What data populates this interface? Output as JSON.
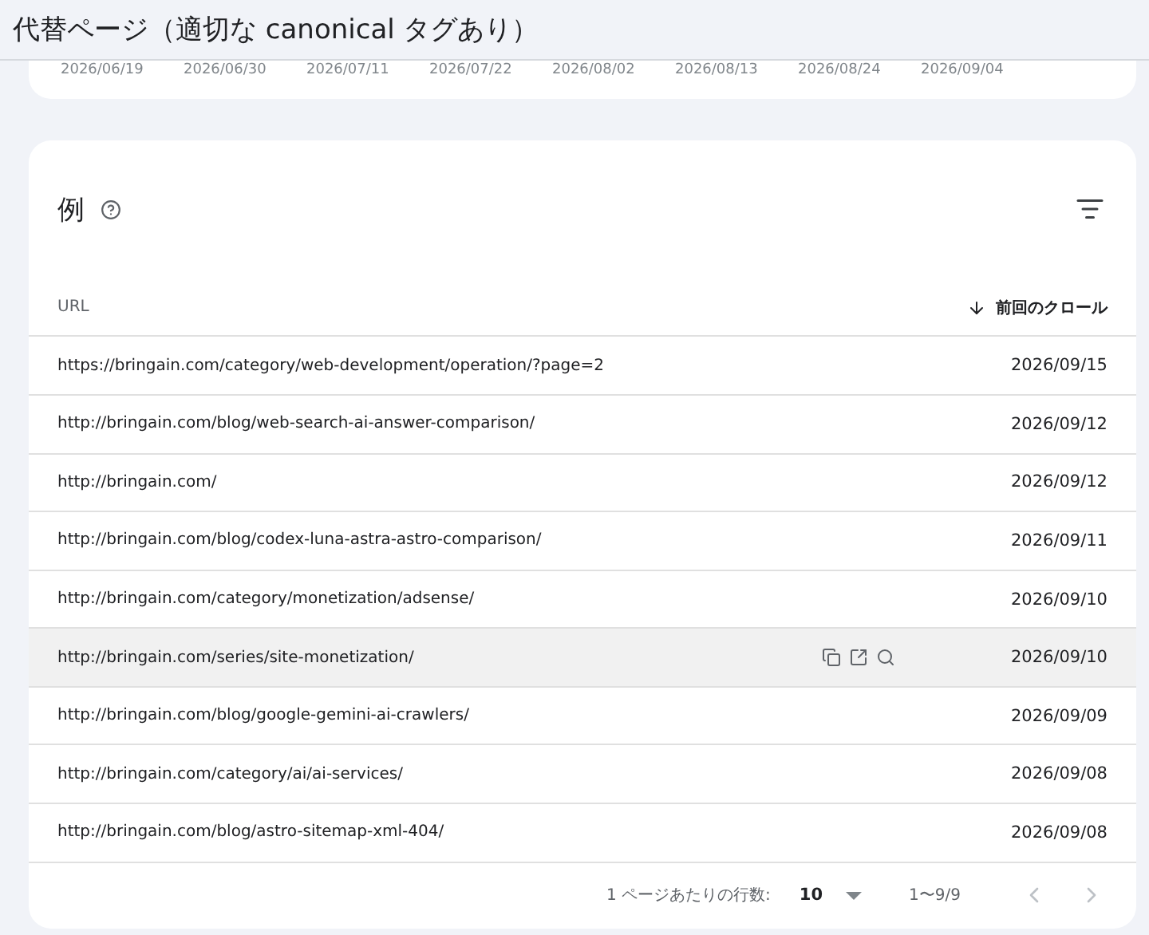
{
  "page_title": "代替ページ（適切な canonical タグあり）",
  "chart_axis": {
    "dates": [
      "2026/06/19",
      "2026/06/30",
      "2026/07/11",
      "2026/07/22",
      "2026/08/02",
      "2026/08/13",
      "2026/08/24",
      "2026/09/04"
    ]
  },
  "examples": {
    "title": "例",
    "columns": [
      {
        "label": "URL",
        "sorted": false
      },
      {
        "label": "前回のクロール",
        "sorted": true
      }
    ],
    "rows": [
      {
        "url": "https://bringain.com/category/web-development/operation/?page=2",
        "date": "2026/09/15",
        "hovered": false
      },
      {
        "url": "http://bringain.com/blog/web-search-ai-answer-comparison/",
        "date": "2026/09/12",
        "hovered": false
      },
      {
        "url": "http://bringain.com/",
        "date": "2026/09/12",
        "hovered": false
      },
      {
        "url": "http://bringain.com/blog/codex-luna-astra-astro-comparison/",
        "date": "2026/09/11",
        "hovered": false
      },
      {
        "url": "http://bringain.com/category/monetization/adsense/",
        "date": "2026/09/10",
        "hovered": false
      },
      {
        "url": "http://bringain.com/series/site-monetization/",
        "date": "2026/09/10",
        "hovered": true
      },
      {
        "url": "http://bringain.com/blog/google-gemini-ai-crawlers/",
        "date": "2026/09/09",
        "hovered": false
      },
      {
        "url": "http://bringain.com/category/ai/ai-services/",
        "date": "2026/09/08",
        "hovered": false
      },
      {
        "url": "http://bringain.com/blog/astro-sitemap-xml-404/",
        "date": "2026/09/08",
        "hovered": false
      }
    ],
    "pagination": {
      "rows_label": "1 ページあたりの行数:",
      "rows_per_page": "10",
      "range": "1〜9/9",
      "prev_disabled": true,
      "next_disabled": true
    }
  }
}
